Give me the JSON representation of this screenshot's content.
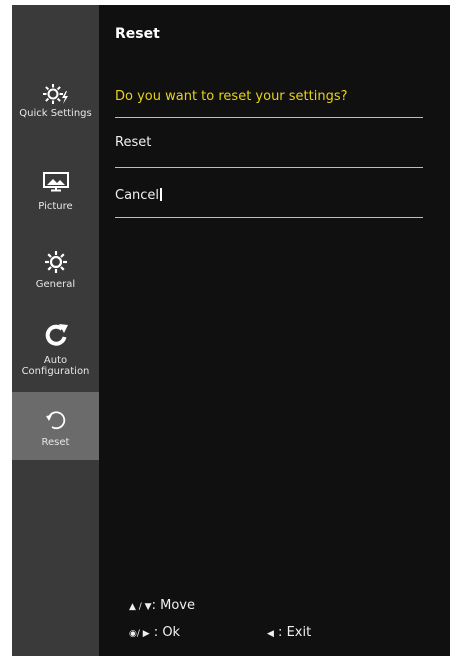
{
  "sidebar": {
    "items": [
      {
        "label": "Quick Settings",
        "icon": "quick-settings-icon",
        "selected": false
      },
      {
        "label": "Picture",
        "icon": "picture-icon",
        "selected": false
      },
      {
        "label": "General",
        "icon": "general-gear-icon",
        "selected": false
      },
      {
        "label": "Auto Configuration",
        "icon": "auto-configuration-icon",
        "selected": false
      },
      {
        "label": "Reset",
        "icon": "reset-icon",
        "selected": true
      }
    ]
  },
  "main": {
    "title": "Reset",
    "question": "Do you want to reset your settings?",
    "options": [
      {
        "label": "Reset"
      },
      {
        "label": "Cancel"
      }
    ]
  },
  "footer": {
    "move_label": "Move",
    "ok_label": "Ok",
    "exit_label": "Exit"
  },
  "colors": {
    "question": "#e7d21a",
    "sidebar_bg": "#3a3a3a",
    "selected_bg": "#6b6b6b",
    "main_bg": "#101010"
  }
}
